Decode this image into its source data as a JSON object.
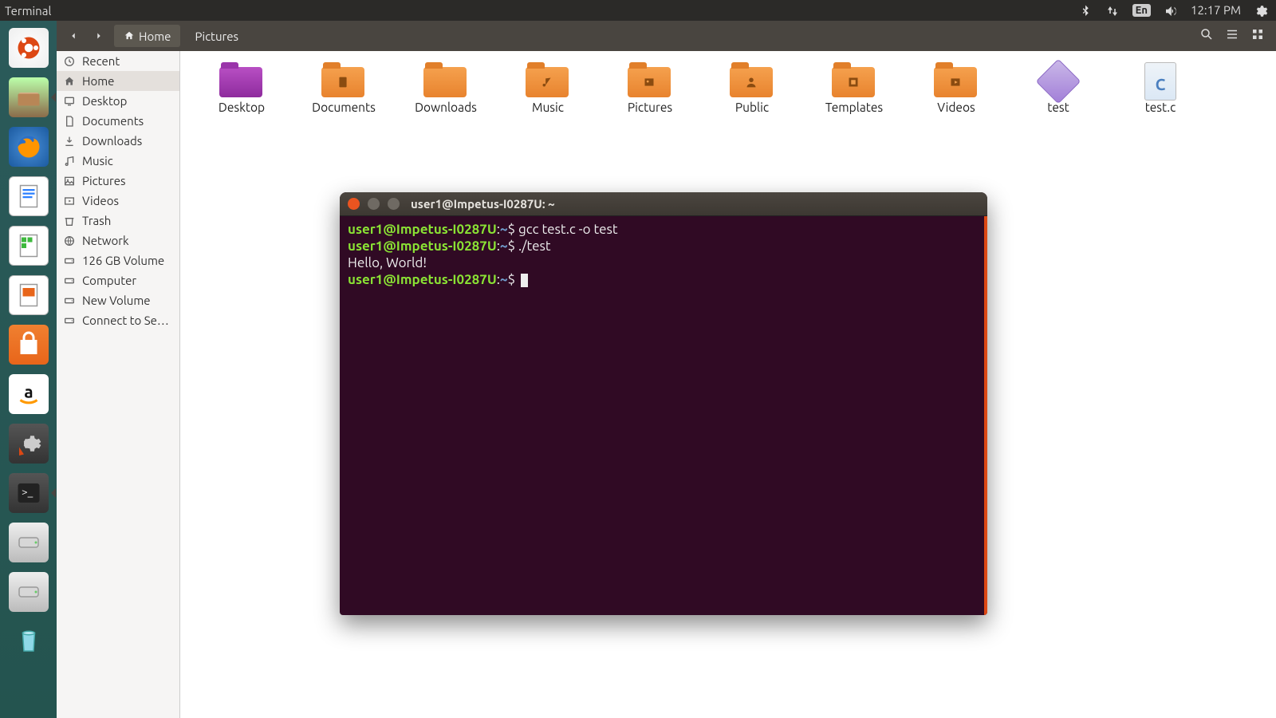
{
  "menubar": {
    "app": "Terminal",
    "lang": "En",
    "time": "12:17 PM"
  },
  "launcher": {
    "items": [
      {
        "name": "dash-icon"
      },
      {
        "name": "files-icon"
      },
      {
        "name": "firefox-icon"
      },
      {
        "name": "writer-icon"
      },
      {
        "name": "calc-icon"
      },
      {
        "name": "impress-icon"
      },
      {
        "name": "software-icon"
      },
      {
        "name": "amazon-icon"
      },
      {
        "name": "settings-icon"
      },
      {
        "name": "terminal-icon"
      },
      {
        "name": "drive1-icon"
      },
      {
        "name": "drive2-icon"
      },
      {
        "name": "trash-icon"
      }
    ]
  },
  "nautilus": {
    "breadcrumbs": [
      "Home",
      "Pictures"
    ],
    "places": [
      {
        "label": "Recent",
        "icon": "clock"
      },
      {
        "label": "Home",
        "icon": "home"
      },
      {
        "label": "Desktop",
        "icon": "desktop"
      },
      {
        "label": "Documents",
        "icon": "doc"
      },
      {
        "label": "Downloads",
        "icon": "down"
      },
      {
        "label": "Music",
        "icon": "music"
      },
      {
        "label": "Pictures",
        "icon": "pic"
      },
      {
        "label": "Videos",
        "icon": "vid"
      },
      {
        "label": "Trash",
        "icon": "trash"
      },
      {
        "label": "Network",
        "icon": "net"
      },
      {
        "label": "126 GB Volume",
        "icon": "disk"
      },
      {
        "label": "Computer",
        "icon": "disk"
      },
      {
        "label": "New Volume",
        "icon": "disk"
      },
      {
        "label": "Connect to Se…",
        "icon": "disk"
      }
    ],
    "places_selected": 1,
    "grid": [
      {
        "label": "Desktop",
        "type": "folder",
        "variant": "purple"
      },
      {
        "label": "Documents",
        "type": "folder",
        "sym": "doc"
      },
      {
        "label": "Downloads",
        "type": "folder",
        "sym": "down"
      },
      {
        "label": "Music",
        "type": "folder",
        "sym": "music"
      },
      {
        "label": "Pictures",
        "type": "folder",
        "sym": "pic"
      },
      {
        "label": "Public",
        "type": "folder",
        "sym": "pub"
      },
      {
        "label": "Templates",
        "type": "folder",
        "sym": "tpl"
      },
      {
        "label": "Videos",
        "type": "folder",
        "sym": "vid"
      },
      {
        "label": "test",
        "type": "exec"
      },
      {
        "label": "test.c",
        "type": "cfile"
      }
    ]
  },
  "terminal": {
    "title": "user1@Impetus-I0287U: ~",
    "prompt_user": "user1@Impetus-I0287U",
    "prompt_path": "~",
    "lines": [
      {
        "cmd": "gcc test.c -o test"
      },
      {
        "cmd": "./test"
      },
      {
        "out": "Hello, World!"
      },
      {
        "cmd": ""
      }
    ]
  }
}
